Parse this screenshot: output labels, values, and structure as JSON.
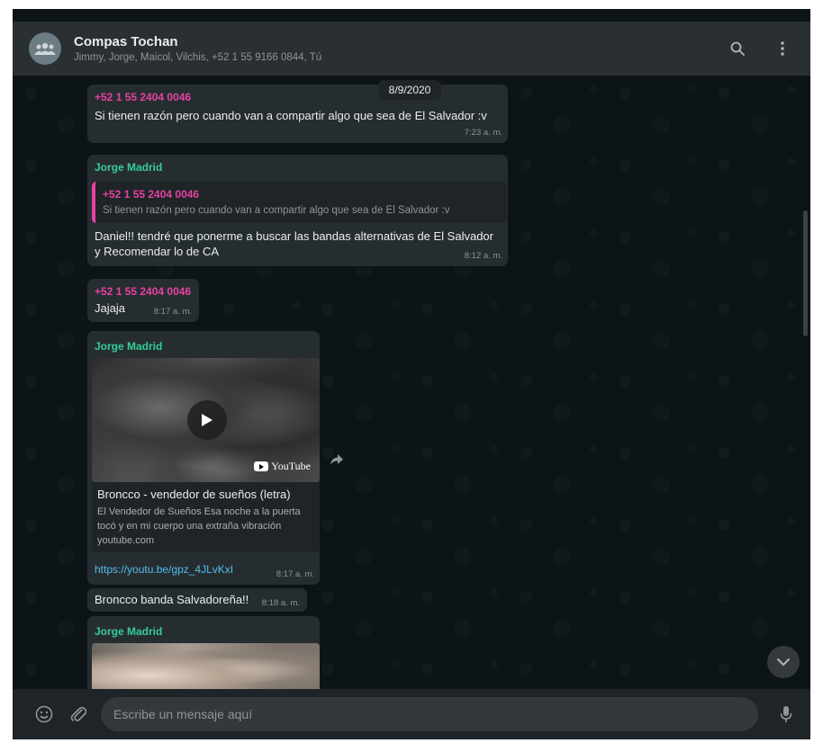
{
  "header": {
    "title": "Compas Tochan",
    "subtitle": "Jimmy, Jorge, Maicol, Vilchis, +52 1 55 9166 0844, Tú",
    "icons": [
      "group-avatar-icon",
      "search-icon",
      "menu-icon"
    ]
  },
  "date_label": "8/9/2020",
  "messages": [
    {
      "sender": "+52 1 55 2404 0046",
      "text": "Si tienen razón pero cuando van a compartir algo que sea de El Salvador :v",
      "time": "7:23 a. m."
    },
    {
      "sender": "Jorge Madrid",
      "quote_sender": "+52 1 55 2404 0046",
      "quote_text": "Si tienen razón pero cuando van a compartir algo que sea de El Salvador :v",
      "text_line1": "Daniel!! tendré que ponerme a buscar las bandas alternativas de El Salvador",
      "text_line2": "y Recomendar lo de CA",
      "time": "8:12 a. m."
    },
    {
      "sender": "+52 1 55 2404 0046",
      "text": "Jajaja",
      "time": "8:17 a. m."
    },
    {
      "sender": "Jorge Madrid",
      "video_brand": "YouTube",
      "link_title": "Broncco - vendedor de sueños (letra)",
      "link_desc": "El Vendedor de Sueños Esa noche a la puerta tocó y en mi cuerpo una extraña vibración",
      "link_domain": "youtube.com",
      "url": "https://youtu.be/gpz_4JLvKxI",
      "time": "8:17 a. m."
    },
    {
      "text": "Broncco banda Salvadoreña!!",
      "time": "8:18 a. m."
    },
    {
      "sender": "Jorge Madrid"
    }
  ],
  "composer": {
    "placeholder": "Escribe un mensaje aquí",
    "icons": [
      "emoji-icon",
      "attach-icon",
      "microphone-icon"
    ]
  },
  "colors": {
    "background": "#0d1418",
    "bubble": "#262d31",
    "header": "#2a2f32",
    "sender_pink": "#e542a3",
    "sender_green": "#35cd96",
    "link": "#53bdeb"
  }
}
